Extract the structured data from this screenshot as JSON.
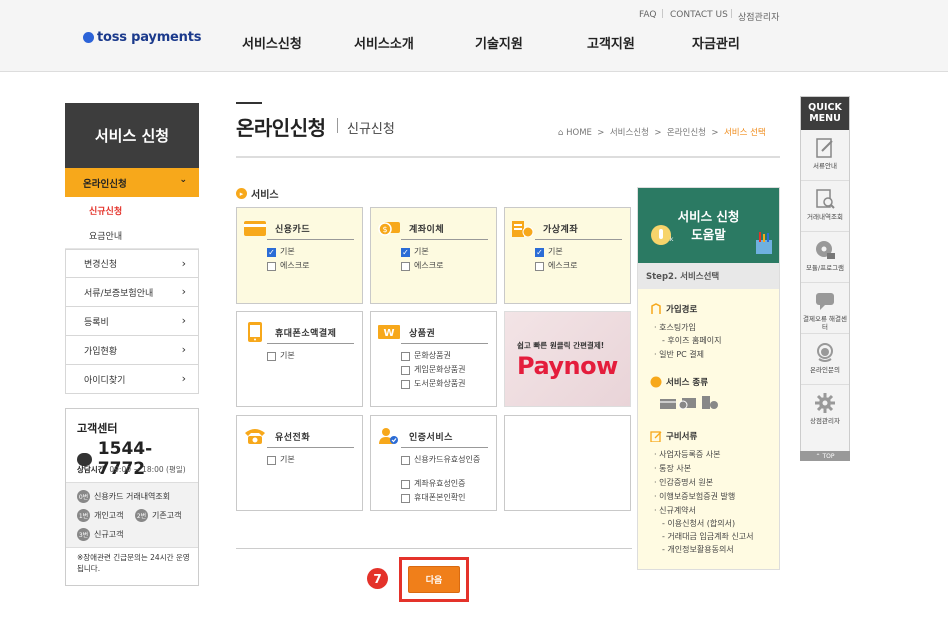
{
  "header": {
    "logo_text": "toss payments",
    "util_links": [
      "FAQ",
      "CONTACT US",
      "상점관리자"
    ],
    "nav": [
      "서비스신청",
      "서비스소개",
      "기술지원",
      "고객지원",
      "자금관리"
    ]
  },
  "sidebar": {
    "title": "서비스 신청",
    "active_item": "온라인신청",
    "sub_items": [
      "신규신청",
      "요금안내"
    ],
    "items": [
      "변경신청",
      "서류/보증보험안내",
      "등록비",
      "가입현황",
      "아이디찾기"
    ]
  },
  "customer_center": {
    "title": "고객센터",
    "phone": "1544-7772",
    "hours_label": "상담시간",
    "hours": "09:00 ~ 18:00 (평일)",
    "options": [
      {
        "num": "0번",
        "label": "신용카드 거래내역조회"
      },
      {
        "num": "1번",
        "label": "개인고객"
      },
      {
        "num": "2번",
        "label": "기존고객"
      },
      {
        "num": "3번",
        "label": "신규고객"
      }
    ],
    "note": "※장애관련 긴급문의는 24시간 운영됩니다."
  },
  "page": {
    "title": "온라인신청",
    "subtitle": "신규신청",
    "breadcrumb": [
      "HOME",
      "서비스신청",
      "온라인신청",
      "서비스 선택"
    ],
    "section_label": "서비스"
  },
  "services": [
    {
      "name": "신용카드",
      "options": [
        {
          "label": "기본",
          "checked": true
        },
        {
          "label": "에스크로",
          "checked": false
        }
      ]
    },
    {
      "name": "계좌이체",
      "options": [
        {
          "label": "기본",
          "checked": true
        },
        {
          "label": "에스크로",
          "checked": false
        }
      ]
    },
    {
      "name": "가상계좌",
      "options": [
        {
          "label": "기본",
          "checked": true
        },
        {
          "label": "에스크로",
          "checked": false
        }
      ]
    },
    {
      "name": "휴대폰소액결제",
      "options": [
        {
          "label": "기본",
          "checked": false
        }
      ]
    },
    {
      "name": "상품권",
      "options": [
        {
          "label": "문화상품권",
          "checked": false
        },
        {
          "label": "게임문화상품권",
          "checked": false
        },
        {
          "label": "도서문화상품권",
          "checked": false
        }
      ]
    },
    {
      "name": "유선전화",
      "options": [
        {
          "label": "기본",
          "checked": false
        }
      ]
    },
    {
      "name": "인증서비스",
      "options": [
        {
          "label": "신용카드유효성인증",
          "checked": false
        },
        {
          "label": "계좌유효성인증",
          "checked": false
        },
        {
          "label": "휴대폰본인확인",
          "checked": false
        }
      ]
    }
  ],
  "promo": {
    "slogan": "쉽고 빠른 원클릭 간편결제!",
    "logo": "Paynow"
  },
  "next_button": {
    "label": "다음",
    "step_badge": "7"
  },
  "help_panel": {
    "banner_line1": "서비스 신청",
    "banner_line2": "도움말",
    "banner_click": "click",
    "step": "Step2. 서비스선택",
    "sections": [
      {
        "title": "가입경로",
        "items": [
          "호스팅가입",
          "- 후이즈 홈페이지",
          "일반 PC 결제"
        ]
      },
      {
        "title": "서비스 종류",
        "items": []
      },
      {
        "title": "구비서류",
        "items": [
          "사업자등록증 사본",
          "통장 사본",
          "인감증명서 원본",
          "이행보증보험증권 발행",
          "신규계약서",
          "- 이용신청서 (합의서)",
          "- 거래대금 입금계좌 신고서",
          "- 개인정보활용동의서"
        ]
      }
    ]
  },
  "quick_menu": {
    "title_line1": "QUICK",
    "title_line2": "MENU",
    "items": [
      {
        "icon": "document-edit-icon",
        "label": "서류안내"
      },
      {
        "icon": "search-document-icon",
        "label": "거래내역조회"
      },
      {
        "icon": "disc-icon",
        "label": "모듈/프로그램"
      },
      {
        "icon": "chat-bubble-icon",
        "label": "결제오류 해결센터"
      },
      {
        "icon": "headset-icon",
        "label": "온라인문의"
      },
      {
        "icon": "gear-icon",
        "label": "상점관리자"
      }
    ],
    "top_label": "TOP"
  },
  "colors": {
    "accent": "#f7a81b",
    "brand": "#1b3a8c",
    "highlight": "#e4322a",
    "button": "#f07f1a",
    "help_banner": "#2b7a63"
  }
}
